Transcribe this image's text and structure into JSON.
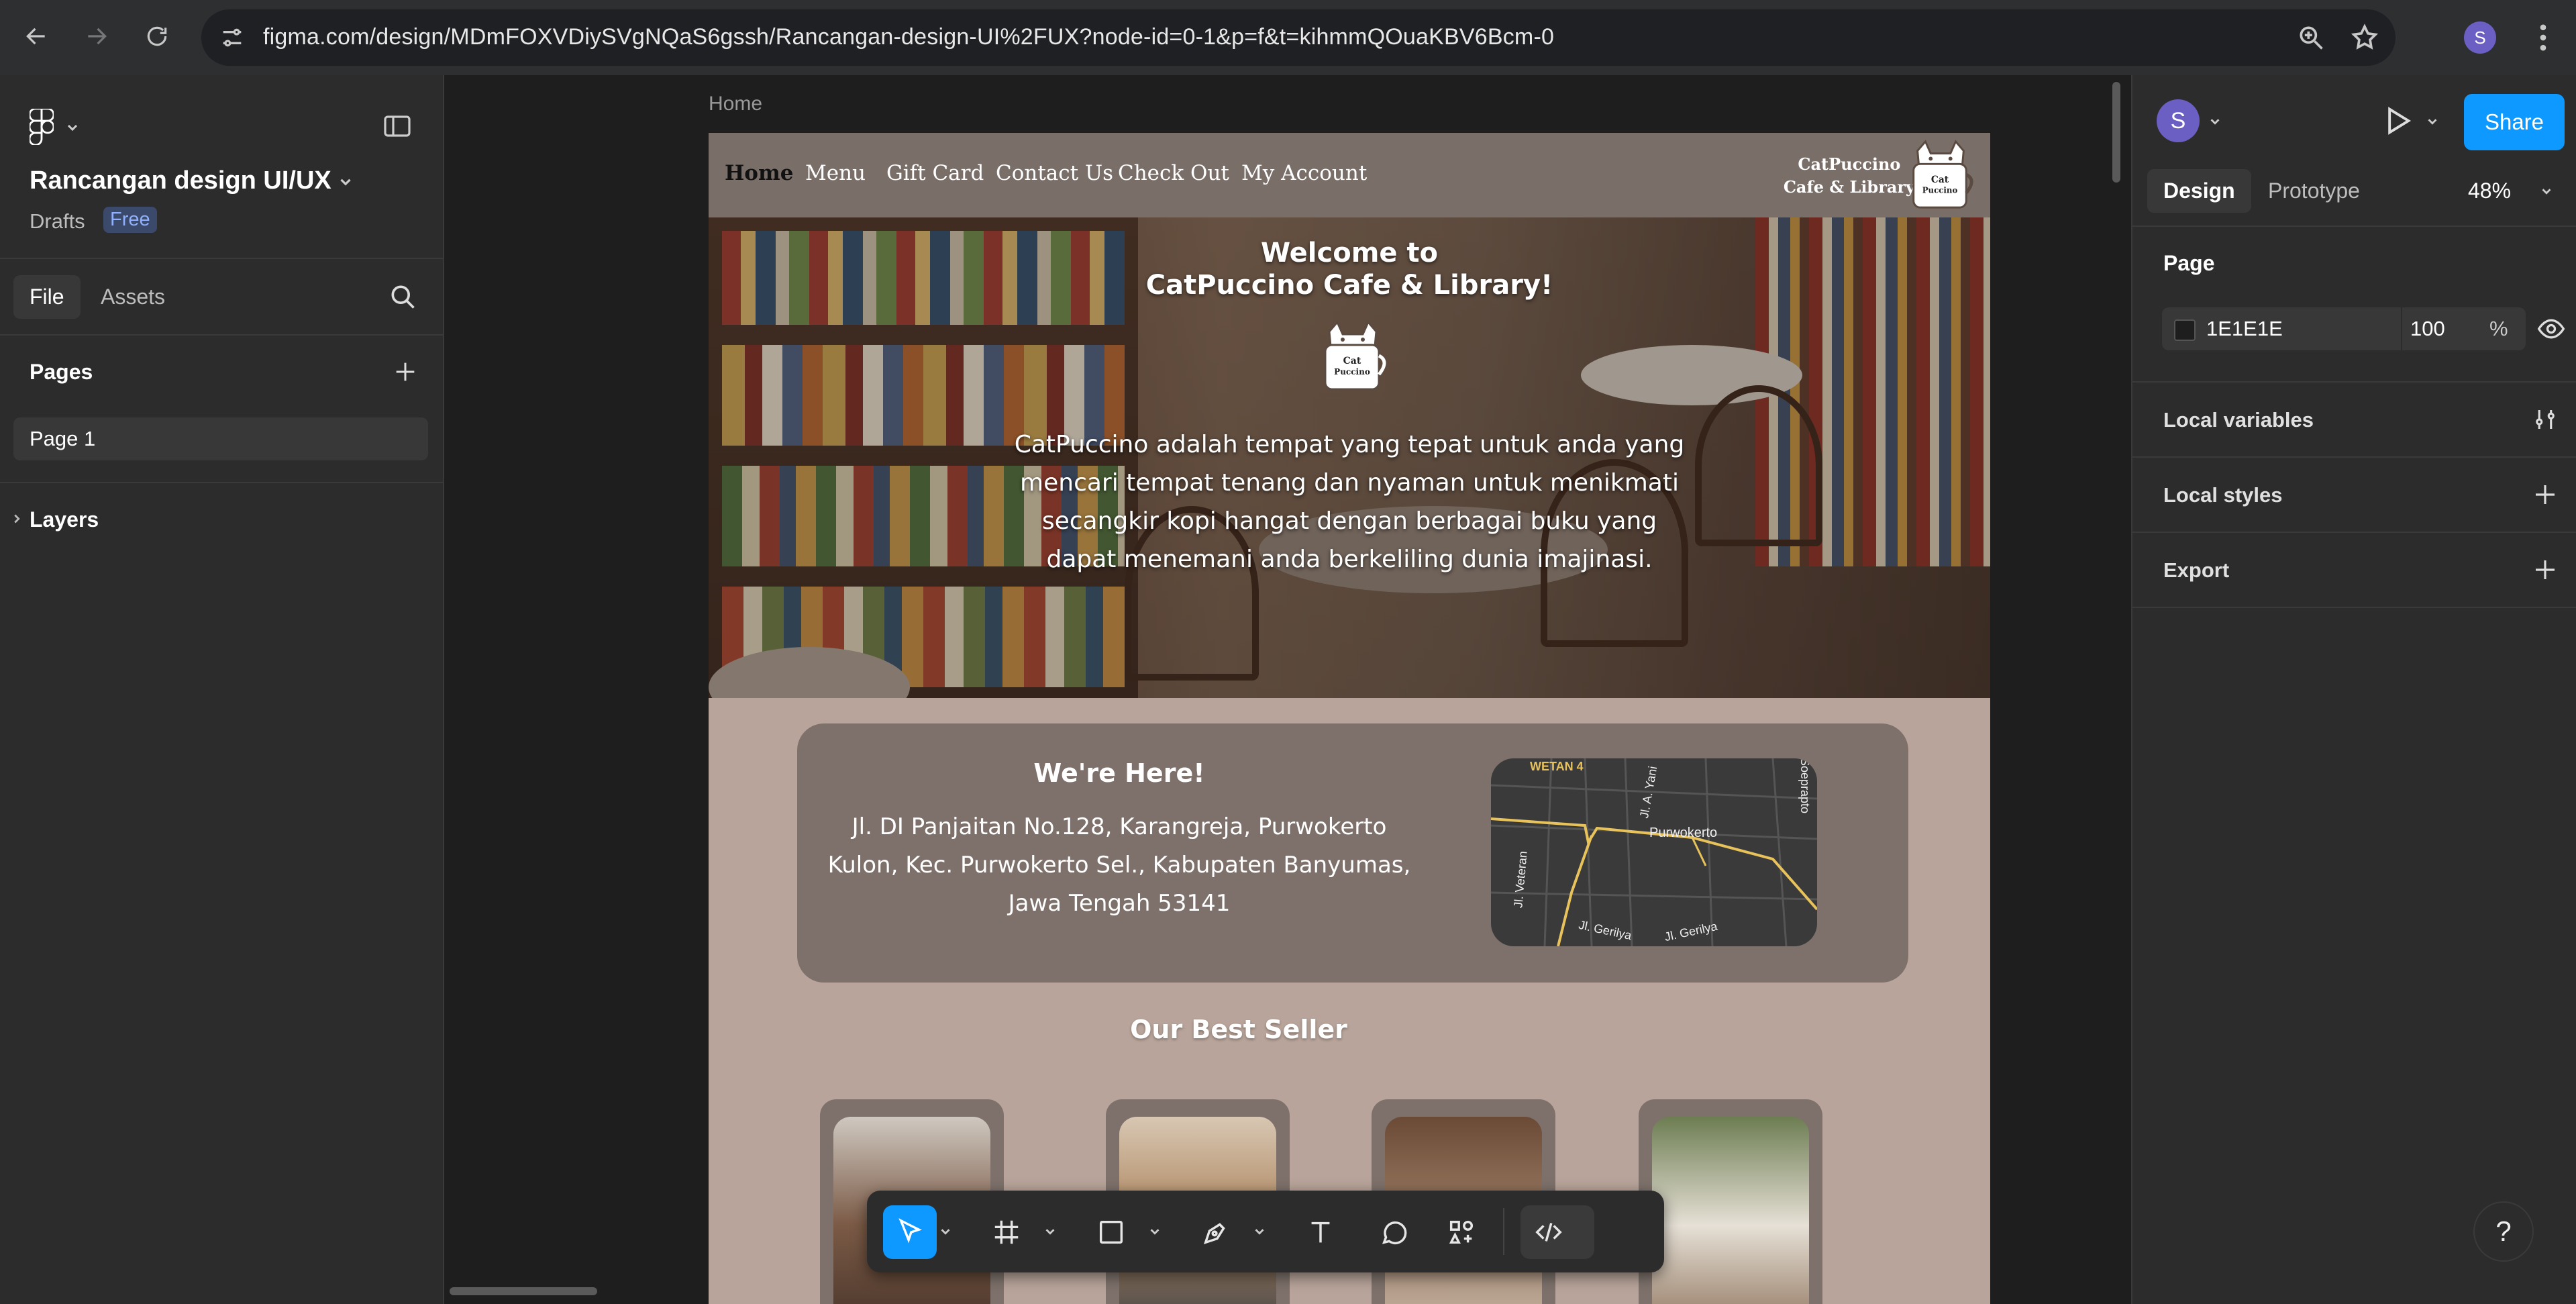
{
  "browser": {
    "url": "figma.com/design/MDmFOXVDiySVgNQaS6gssh/Rancangan-design-UI%2FUX?node-id=0-1&p=f&t=kihmmQOuaKBV6Bcm-0",
    "profile_initial": "S"
  },
  "left_panel": {
    "file_name": "Rancangan design UI/UX",
    "location": "Drafts",
    "plan_badge": "Free",
    "tabs": {
      "file": "File",
      "assets": "Assets"
    },
    "pages_title": "Pages",
    "pages": [
      "Page 1"
    ],
    "layers_title": "Layers"
  },
  "canvas": {
    "frame_label": "Home",
    "site": {
      "nav": [
        "Home",
        "Menu",
        "Gift Card",
        "Contact Us",
        "Check Out",
        "My Account"
      ],
      "brand_line1": "CatPuccino",
      "brand_line2": "Cafe & Library",
      "logo_text_line1": "Cat",
      "logo_text_line2": "Puccino",
      "hero_title_line1": "Welcome to",
      "hero_title_line2": "CatPuccino Cafe & Library!",
      "hero_text": "CatPuccino adalah tempat yang tepat untuk anda yang mencari tempat tenang dan nyaman untuk menikmati secangkir kopi hangat dengan berbagai buku yang dapat menemani anda berkeliling dunia imajinasi.",
      "location_title": "We're Here!",
      "location_address": "Jl. DI Panjaitan No.128, Karangreja, Purwokerto Kulon, Kec. Purwokerto Sel., Kabupaten Banyumas, Jawa Tengah 53141",
      "map_labels": {
        "area": "WETAN 4",
        "city": "Purwokerto",
        "street1": "Jl. A. Yani",
        "street2": "Jl. Veteran",
        "street3": "Jl. Gerilya",
        "street4": "Jl. Gerilya",
        "street5": "Soeprapto"
      },
      "best_seller_title": "Our Best Seller"
    }
  },
  "right_panel": {
    "profile_initial": "S",
    "share_label": "Share",
    "tabs": {
      "design": "Design",
      "prototype": "Prototype"
    },
    "zoom": "48%",
    "page_section": "Page",
    "page_color_hex": "1E1E1E",
    "page_opacity": "100",
    "percent_sign": "%",
    "local_variables": "Local variables",
    "local_styles": "Local styles",
    "export": "Export",
    "help": "?"
  },
  "colors": {
    "accent": "#0d99ff",
    "site_background": "#b8a49a",
    "site_nav": "#7a6e68",
    "card": "#7e716b"
  }
}
